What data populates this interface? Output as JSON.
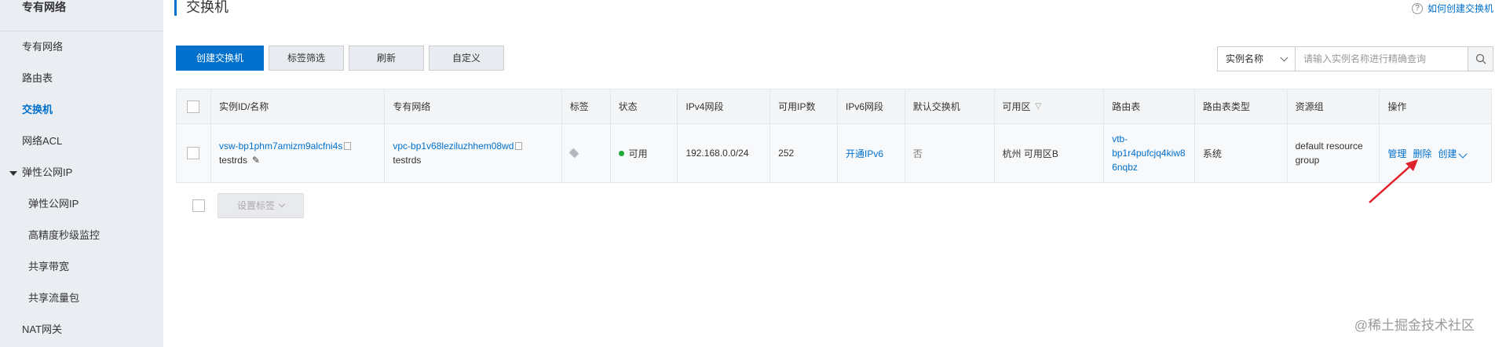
{
  "sidebar": {
    "title": "专有网络",
    "items": [
      {
        "label": "专有网络"
      },
      {
        "label": "路由表"
      },
      {
        "label": "交换机"
      },
      {
        "label": "网络ACL"
      },
      {
        "label": "弹性公网IP"
      },
      {
        "label": "弹性公网IP"
      },
      {
        "label": "高精度秒级监控"
      },
      {
        "label": "共享带宽"
      },
      {
        "label": "共享流量包"
      },
      {
        "label": "NAT网关"
      }
    ]
  },
  "header": {
    "title": "交换机",
    "help_link": "如何创建交换机",
    "help_icon": "?"
  },
  "toolbar": {
    "create_label": "创建交换机",
    "tag_filter_label": "标签筛选",
    "refresh_label": "刷新",
    "customize_label": "自定义"
  },
  "search": {
    "field_label": "实例名称",
    "placeholder": "请输入实例名称进行精确查询"
  },
  "table": {
    "columns": [
      "实例ID/名称",
      "专有网络",
      "标签",
      "状态",
      "IPv4网段",
      "可用IP数",
      "IPv6网段",
      "默认交换机",
      "可用区",
      "路由表",
      "路由表类型",
      "资源组",
      "操作"
    ],
    "rows": [
      {
        "instance_id": "vsw-bp1phm7amizm9alcfni4s",
        "instance_name": "testrds",
        "vpc_id": "vpc-bp1v68leziluzhhem08wd",
        "vpc_name": "testrds",
        "status": "可用",
        "ipv4": "192.168.0.0/24",
        "available_ips": "252",
        "ipv6": "开通IPv6",
        "default_switch": "否",
        "zone": "杭州 可用区B",
        "route_table_line1": "vtb-",
        "route_table_line2": "bp1r4pufcjq4kiw8",
        "route_table_line3": "6nqbz",
        "route_table_type": "系统",
        "resource_group_line1": "default resource",
        "resource_group_line2": "group",
        "action_manage": "管理",
        "action_delete": "删除",
        "action_create": "创建"
      }
    ]
  },
  "footer": {
    "set_tag_label": "设置标签"
  },
  "watermark": {
    "text": "@稀土掘金技术社区"
  },
  "colors": {
    "accent": "#0070cc",
    "status_ok": "#1eaa39",
    "arrow": "#e0202a"
  }
}
